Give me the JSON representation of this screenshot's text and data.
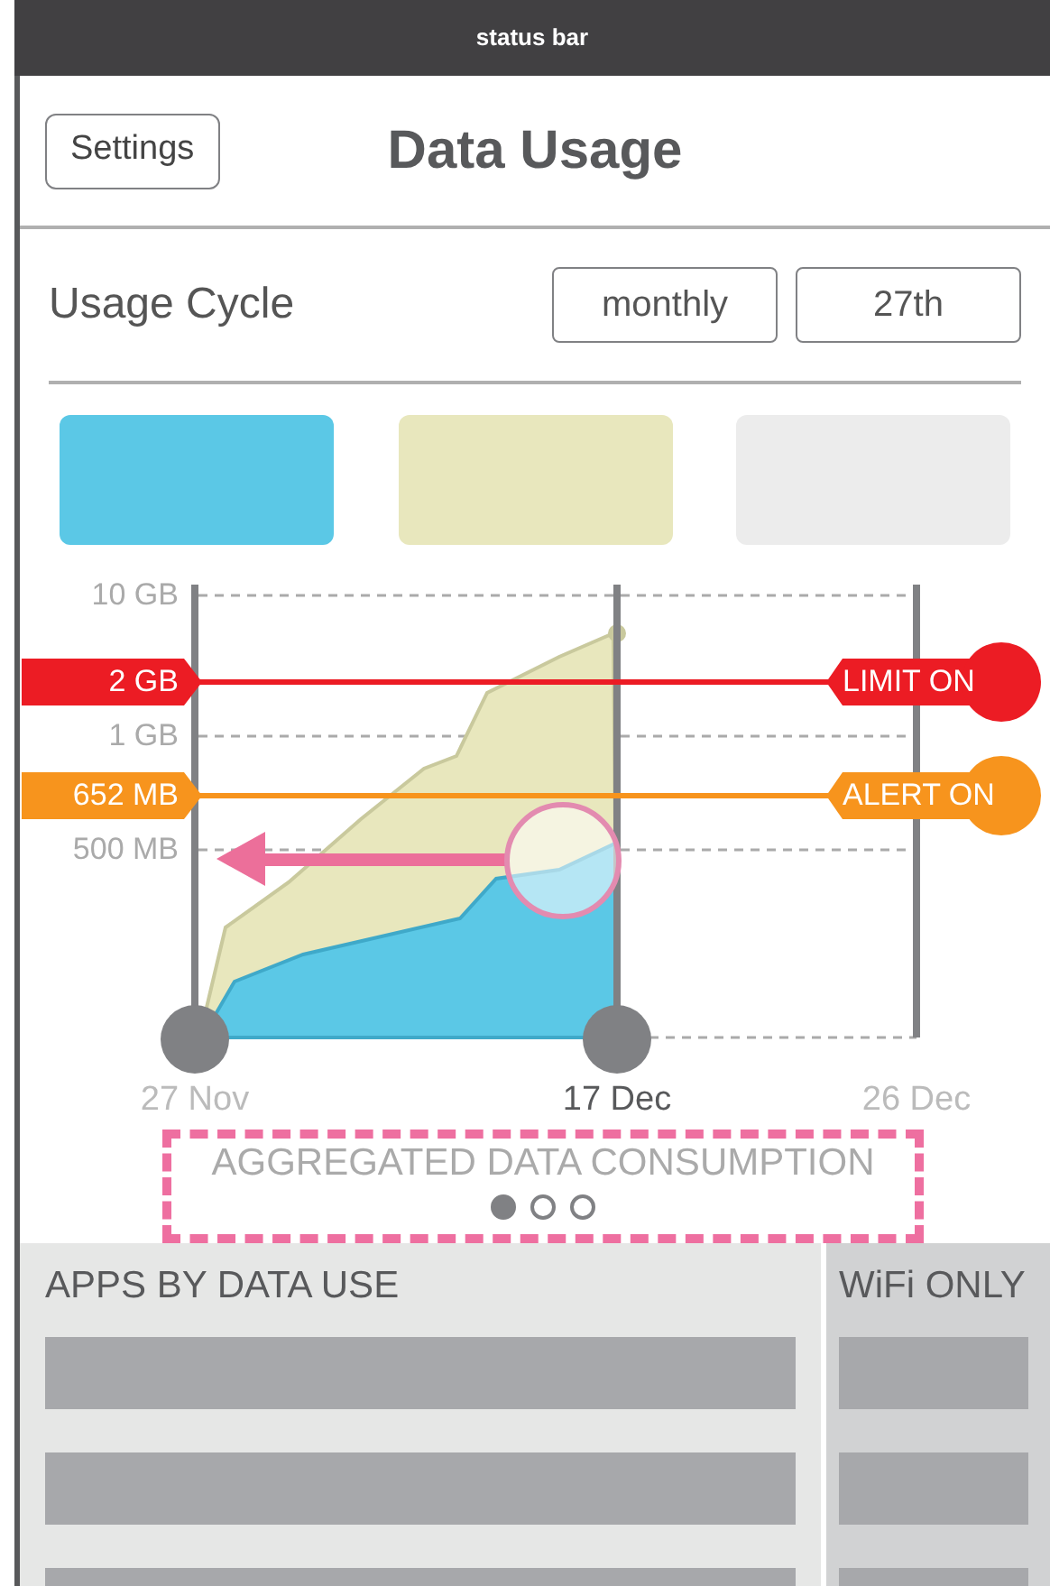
{
  "status_bar": {
    "title": "status bar"
  },
  "header": {
    "back_button": "Settings",
    "title": "Data Usage"
  },
  "usage_cycle": {
    "label": "Usage Cycle",
    "buttons": [
      "monthly",
      "27th"
    ]
  },
  "legend": [
    {
      "color": "#5bc8e6"
    },
    {
      "color": "#e8e7bd"
    },
    {
      "color": "#ececec"
    }
  ],
  "chart": {
    "y_labels": [
      "10 GB",
      "1 GB",
      "500 MB"
    ],
    "limit": {
      "value": "2 GB",
      "label": "LIMIT ON"
    },
    "alert": {
      "value": "652 MB",
      "label": "ALERT ON"
    },
    "x_labels": [
      {
        "text": "27 Nov",
        "selected": false
      },
      {
        "text": "17 Dec",
        "selected": true
      },
      {
        "text": "26 Dec",
        "selected": false
      }
    ]
  },
  "caption": "AGGREGATED DATA CONSUMPTION",
  "pager": [
    {
      "selected": true
    },
    {
      "selected": false
    },
    {
      "selected": false
    }
  ],
  "apps_panel": {
    "title": "APPS BY DATA USE"
  },
  "wifi_panel": {
    "title": "WiFi ONLY"
  }
}
